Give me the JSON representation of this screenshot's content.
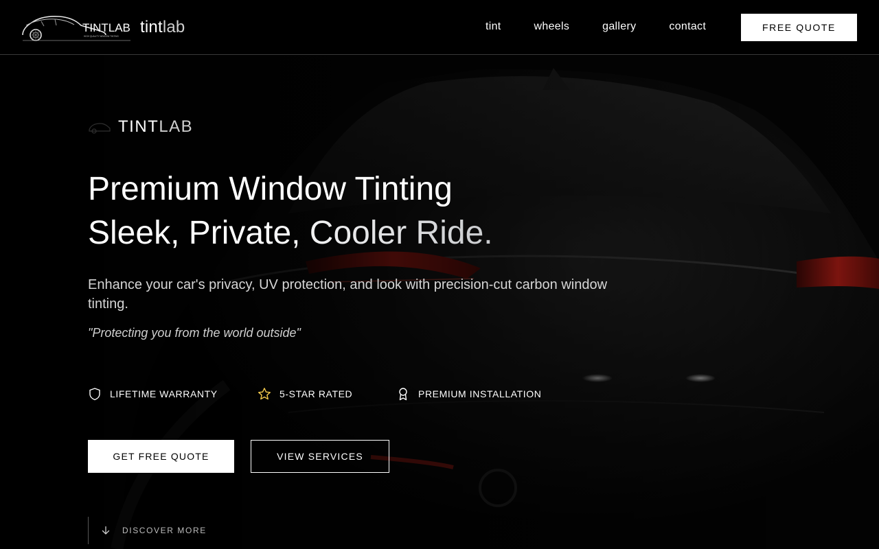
{
  "header": {
    "logo_wordmark": "TINTLAB",
    "logo_tagline": "HIGH QUALITY WINDOW TINTING",
    "brand_name_part1": "tint",
    "brand_name_part2": "lab",
    "nav": [
      {
        "label": "tint"
      },
      {
        "label": "wheels"
      },
      {
        "label": "gallery"
      },
      {
        "label": "contact"
      }
    ],
    "cta_label": "FREE QUOTE"
  },
  "hero": {
    "brand_part1": "TINT",
    "brand_part2": "LAB",
    "headline_line1": "Premium Window Tinting",
    "headline_line2": "Sleek, Private, Cooler Ride.",
    "lead": "Enhance your car's privacy, UV protection, and look with precision-cut carbon window tinting.",
    "quote": "\"Protecting you from the world outside\"",
    "features": [
      {
        "icon": "shield-icon",
        "label": "LIFETIME WARRANTY"
      },
      {
        "icon": "star-icon",
        "label": "5-STAR RATED"
      },
      {
        "icon": "award-icon",
        "label": "PREMIUM INSTALLATION"
      }
    ],
    "primary_button": "GET FREE QUOTE",
    "secondary_button": "VIEW SERVICES",
    "discover_label": "DISCOVER MORE"
  },
  "colors": {
    "background": "#000000",
    "text": "#ffffff",
    "muted_text": "#d6d6d6",
    "star_accent": "#f2c94c",
    "taillight_red": "#e0281e"
  }
}
